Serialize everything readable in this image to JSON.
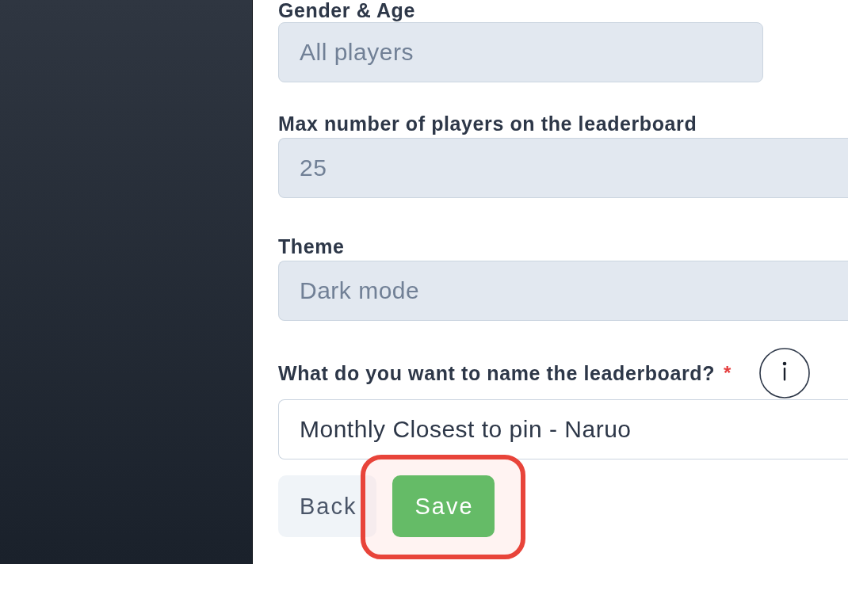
{
  "form": {
    "fields": [
      {
        "label": "Gender & Age",
        "value": "All players",
        "disabled": true,
        "info_button": false
      },
      {
        "label": "Max number of players on the leaderboard",
        "value": "25",
        "disabled": true,
        "info_button": false
      },
      {
        "label": "Theme",
        "value": "Dark mode",
        "disabled": true,
        "info_button": false
      },
      {
        "label": "What do you want to name the leaderboard?",
        "required_mark": "*",
        "value": "Monthly Closest to pin - Naruo",
        "disabled": false,
        "info_button": true
      }
    ]
  },
  "buttons": [
    {
      "label": "Back",
      "kind": "secondary",
      "highlighted": false
    },
    {
      "label": "Save",
      "kind": "primary",
      "highlighted": true
    }
  ]
}
